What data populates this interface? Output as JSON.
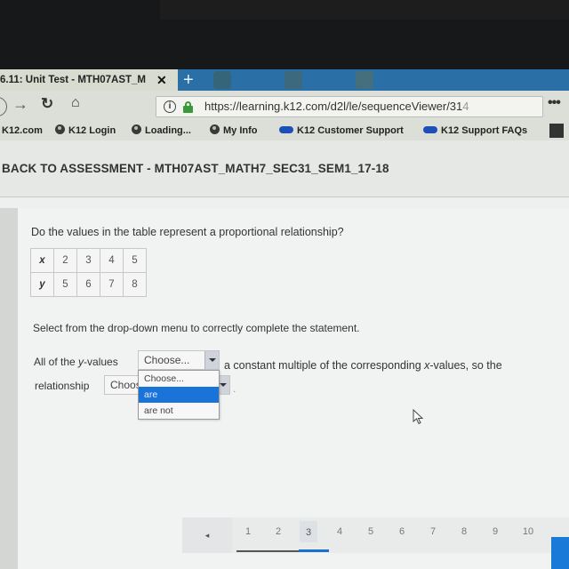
{
  "browser": {
    "tab": {
      "title": "6.11: Unit Test - MTH07AST_M",
      "close_icon": "close-icon"
    },
    "new_tab_label": "+",
    "url": {
      "main": "https://learning.k12.com/d2l/le/sequenceViewer/31",
      "faded": "4"
    },
    "more_label": "•••",
    "bookmarks": [
      {
        "label": "K12.com",
        "icon": "none"
      },
      {
        "label": "K12 Login",
        "icon": "globe-icon"
      },
      {
        "label": "Loading...",
        "icon": "globe-icon"
      },
      {
        "label": "My Info",
        "icon": "globe-icon"
      },
      {
        "label": "K12 Customer Support",
        "icon": "cloud-icon"
      },
      {
        "label": "K12 Support FAQs",
        "icon": "cloud-icon"
      }
    ]
  },
  "page": {
    "back_link": "BACK TO ASSESSMENT - MTH07AST_MATH7_SEC31_SEM1_17-18",
    "question": "Do the values in the table represent a proportional relationship?",
    "table": {
      "rows": [
        {
          "header": "x",
          "values": [
            "2",
            "3",
            "4",
            "5"
          ]
        },
        {
          "header": "y",
          "values": [
            "5",
            "6",
            "7",
            "8"
          ]
        }
      ]
    },
    "instruction": "Select from the drop-down menu to correctly complete the statement.",
    "statement": {
      "part1_prefix": "All of the ",
      "part1_var": "y",
      "part1_suffix": "-values",
      "part2_prefix": "a constant multiple of the corresponding ",
      "part2_var": "x",
      "part2_suffix": "-values, so the",
      "part3": "relationship"
    },
    "select1": {
      "value": "Choose...",
      "options": [
        "Choose...",
        "are",
        "are not"
      ],
      "highlighted": "are"
    },
    "select2": {
      "value": "Choose..."
    },
    "pager": {
      "prev_icon": "◂",
      "pages": [
        "1",
        "2",
        "3",
        "4",
        "5",
        "6",
        "7",
        "8",
        "9",
        "10"
      ],
      "current": "3"
    }
  }
}
